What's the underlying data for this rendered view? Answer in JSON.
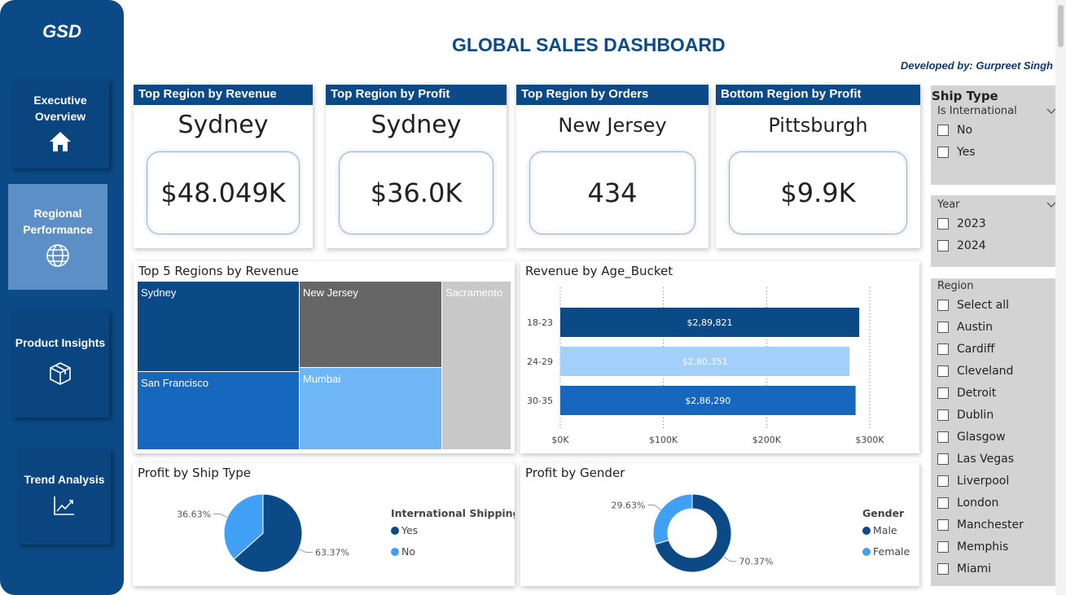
{
  "app": {
    "logo": "GSD",
    "title": "GLOBAL SALES DASHBOARD",
    "developer": "Developed by: Gurpreet Singh"
  },
  "nav": [
    {
      "line1": "Executive",
      "line2": "Overview",
      "icon": "home-icon",
      "active": false
    },
    {
      "line1": "Regional",
      "line2": "Performance",
      "icon": "globe-icon",
      "active": true
    },
    {
      "line1": "Product Insights",
      "line2": "",
      "icon": "box-icon",
      "active": false
    },
    {
      "line1": "Trend Analysis",
      "line2": "",
      "icon": "trend-icon",
      "active": false
    }
  ],
  "kpis": [
    {
      "title": "Top Region by Revenue",
      "region": "Sydney",
      "value": "$48.049K"
    },
    {
      "title": "Top Region by Profit",
      "region": "Sydney",
      "value": "$36.0K"
    },
    {
      "title": "Top Region by Orders",
      "region": "New Jersey",
      "value": "434"
    },
    {
      "title": "Bottom Region by Profit",
      "region": "Pittsburgh",
      "value": "$9.9K"
    }
  ],
  "treemap": {
    "title": "Top 5 Regions by Revenue",
    "tiles": [
      {
        "name": "Sydney",
        "color": "#0b4a86"
      },
      {
        "name": "San Francisco",
        "color": "#1668bf"
      },
      {
        "name": "New Jersey",
        "color": "#666666"
      },
      {
        "name": "Mumbai",
        "color": "#6fb6f6"
      },
      {
        "name": "Sacramento",
        "color": "#c8c8c8"
      }
    ]
  },
  "chart_data": [
    {
      "type": "bar",
      "orientation": "horizontal",
      "title": "Revenue by Age_Bucket",
      "categories": [
        "18-23",
        "24-29",
        "30-35"
      ],
      "values": [
        289821,
        280351,
        286290
      ],
      "data_labels": [
        "$2,89,821",
        "$2,80,351",
        "$2,86,290"
      ],
      "colors": [
        "#0b4a86",
        "#a3d0fb",
        "#1668bf"
      ],
      "xlim": [
        0,
        300000
      ],
      "xticks": [
        0,
        100000,
        200000,
        300000
      ],
      "xtick_labels": [
        "$0K",
        "$100K",
        "$200K",
        "$300K"
      ],
      "grid": "vertical-dotted"
    },
    {
      "type": "pie",
      "title": "Profit by Ship Type",
      "legend_title": "International Shipping",
      "legend_position": "right",
      "labels": [
        "Yes",
        "No"
      ],
      "values": [
        63.37,
        36.63
      ],
      "data_labels": [
        "63.37%",
        "36.63%"
      ],
      "colors": [
        "#0b4a86",
        "#40a0f6"
      ]
    },
    {
      "type": "pie",
      "donut": true,
      "title": "Profit by Gender",
      "legend_title": "Gender",
      "legend_position": "right",
      "labels": [
        "Male",
        "Female"
      ],
      "values": [
        70.37,
        29.63
      ],
      "data_labels": [
        "70.37%",
        "29.63%"
      ],
      "colors": [
        "#0b4a86",
        "#40a0f6"
      ]
    }
  ],
  "slicers": {
    "ship_type": {
      "title": "Ship Type",
      "field": "Is International",
      "options": [
        "No",
        "Yes"
      ]
    },
    "year": {
      "field": "Year",
      "options": [
        "2023",
        "2024"
      ]
    },
    "region": {
      "field": "Region",
      "options": [
        "Select all",
        "Austin",
        "Cardiff",
        "Cleveland",
        "Detroit",
        "Dublin",
        "Glasgow",
        "Las Vegas",
        "Liverpool",
        "London",
        "Manchester",
        "Memphis",
        "Miami"
      ]
    }
  }
}
